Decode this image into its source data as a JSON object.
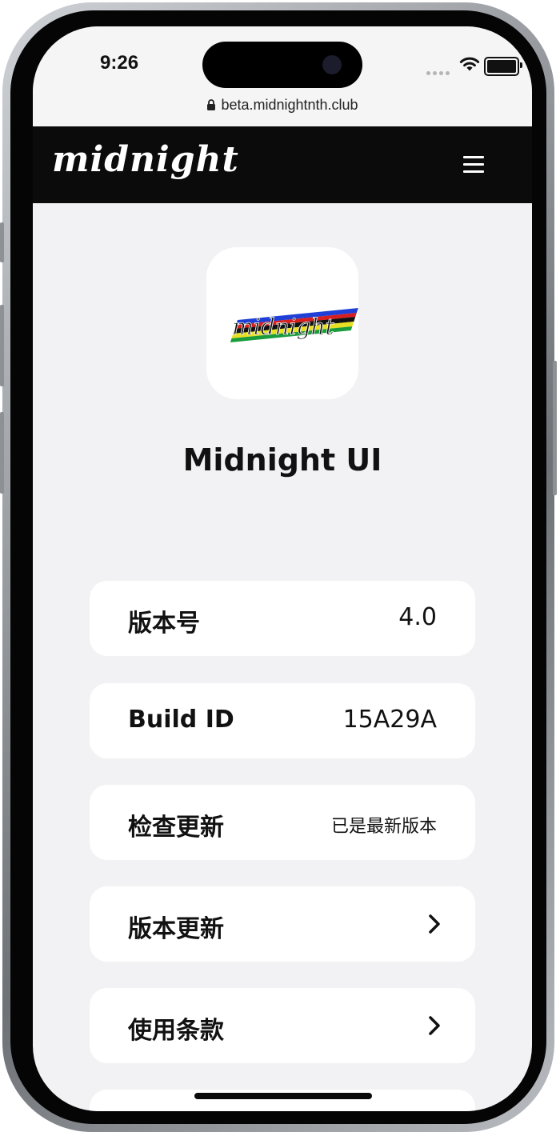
{
  "status_bar": {
    "time": "9:26",
    "url": "beta.midnightnth.club",
    "icons": [
      "signal-dots-icon",
      "wifi-icon",
      "battery-icon",
      "lock-icon"
    ]
  },
  "header": {
    "brand": "midnight",
    "menu_icon": "hamburger-menu-icon"
  },
  "app": {
    "logo_text": "midnight",
    "logo_stripe_colors": [
      "#1f3fd6",
      "#d81e1e",
      "#111111",
      "#e8e023",
      "#1a9b3c"
    ],
    "name": "Midnight UI"
  },
  "rows": [
    {
      "label": "版本号",
      "value": "4.0"
    },
    {
      "label": "Build ID",
      "value": "15A29A"
    },
    {
      "label": "检查更新",
      "value": "已是最新版本"
    },
    {
      "label": "版本更新",
      "icon": "chevron-right-icon"
    },
    {
      "label": "使用条款",
      "icon": "chevron-right-icon"
    }
  ],
  "colors": {
    "navbar": "#0b0b0b",
    "screen_background": "#f2f2f4",
    "card": "#ffffff"
  }
}
